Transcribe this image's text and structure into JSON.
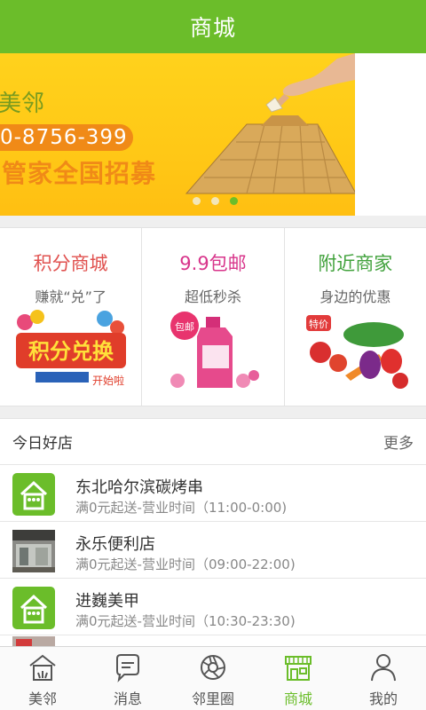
{
  "header": {
    "title": "商城"
  },
  "banner": {
    "brand": "美邻",
    "phone": "0-8756-399",
    "slogan": "管家全国招募",
    "slide_count": 3,
    "active_slide": 3
  },
  "promos": [
    {
      "title": "积分商城",
      "subtitle": "赚就“兑”了",
      "image_text": "积分兑换",
      "image_subtext": "开始啦",
      "color": "#e0504e"
    },
    {
      "title": "9.9包邮",
      "subtitle": "超低秒杀",
      "image_text": "包邮",
      "color": "#d8358b"
    },
    {
      "title": "附近商家",
      "subtitle": "身边的优惠",
      "image_text": "特价",
      "color": "#41a23c"
    }
  ],
  "shops": {
    "heading": "今日好店",
    "more": "更多",
    "items": [
      {
        "name": "东北哈尔滨碳烤串",
        "info": "满0元起送-营业时间（11:00-0:00)",
        "thumb": "house-logo-icon"
      },
      {
        "name": "永乐便利店",
        "info": "满0元起送-营业时间（09:00-22:00)",
        "thumb": "store-photo"
      },
      {
        "name": "进巍美甲",
        "info": "满0元起送-营业时间（10:30-23:30)",
        "thumb": "house-logo-icon"
      }
    ]
  },
  "tabs": [
    {
      "label": "美邻",
      "icon": "house-icon",
      "active": false
    },
    {
      "label": "消息",
      "icon": "chat-bubble-icon",
      "active": false
    },
    {
      "label": "邻里圈",
      "icon": "aperture-icon",
      "active": false
    },
    {
      "label": "商城",
      "icon": "shop-icon",
      "active": true
    },
    {
      "label": "我的",
      "icon": "person-icon",
      "active": false
    }
  ],
  "colors": {
    "primary": "#6bbd2a",
    "banner": "#ffc816",
    "accent_orange": "#f08a17"
  }
}
